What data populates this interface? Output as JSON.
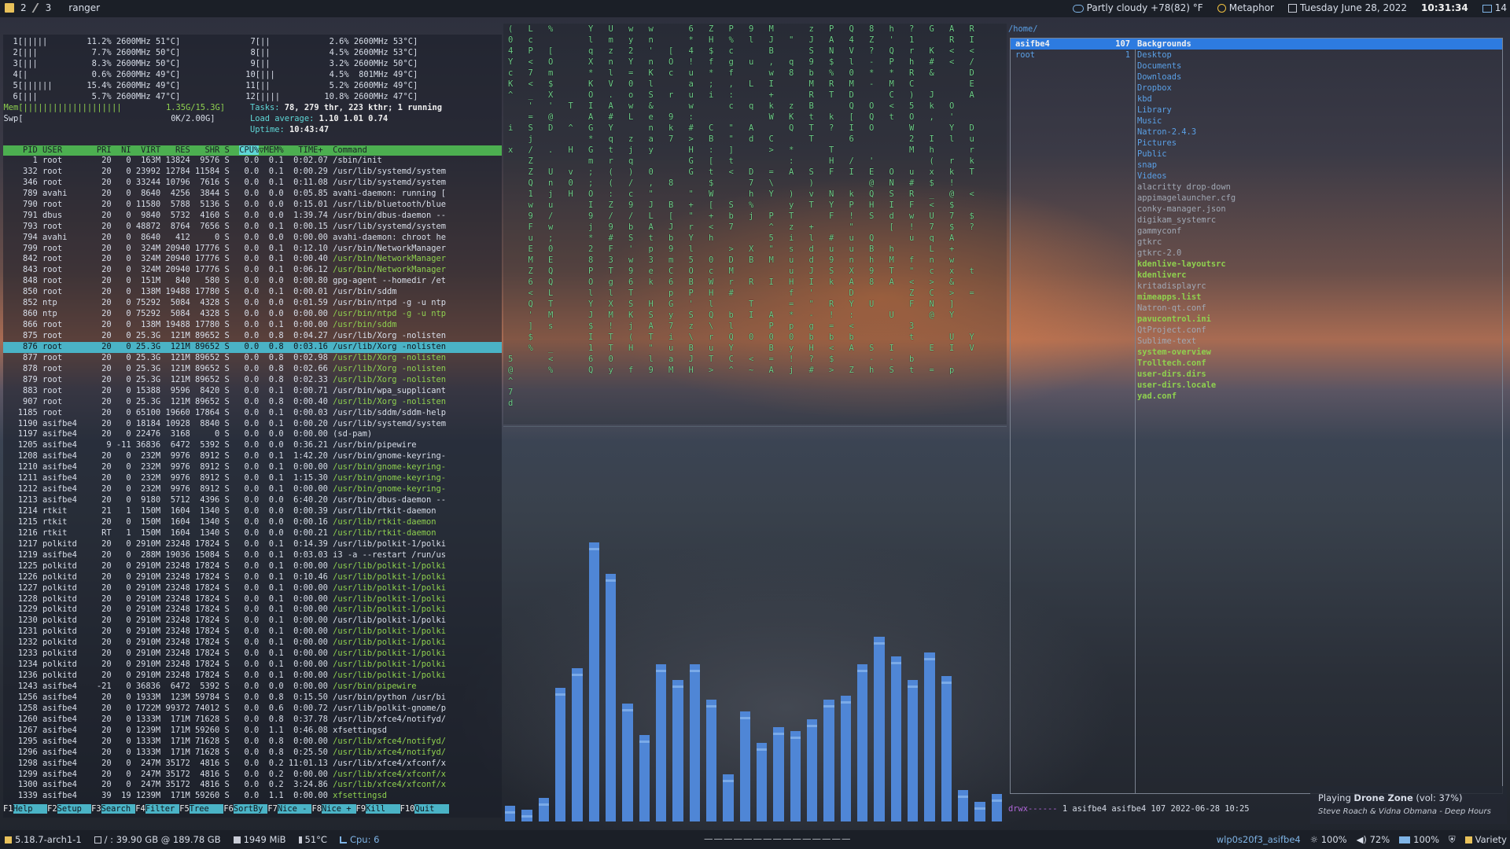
{
  "topbar": {
    "ws1_num": "2",
    "ws2_num": "3",
    "window_title": "ranger",
    "weather": "Partly cloudy +78(82) °F",
    "music": "Metaphor",
    "date": "Tuesday  June 28, 2022",
    "time": "10:31:34",
    "notif_count": "14"
  },
  "htop": {
    "cpu_lines": [
      "  1[|||||        11.2% 2600MHz 51°C]",
      "  2[|||           7.7% 2600MHz 50°C]",
      "  3[|||           8.3% 2600MHz 50°C]",
      "  4[|             0.6% 2600MHz 49°C]",
      "  5[||||||       15.4% 2600MHz 49°C]",
      "  6[|||           5.7% 2600MHz 47°C]"
    ],
    "cpu_lines_r": [
      "  7[||            2.6% 2600MHz 53°C]",
      "  8[||            4.5% 2600MHz 53°C]",
      "  9[||            3.2% 2600MHz 50°C]",
      " 10[|||           4.5%  801MHz 49°C]",
      " 11[||            5.2% 2600MHz 49°C]",
      " 12[||||         10.8% 2600MHz 47°C]"
    ],
    "mem_line": "  Mem[||||||||||||||||||||         1.35G/15.3G]",
    "swp_line": "  Swp[                              0K/2.00G]",
    "tasks_label": "Tasks: ",
    "tasks_val": "78, 279 thr, 223 kthr; 1 running",
    "load_label": "Load average: ",
    "load_val": "1.10 1.01 0.74",
    "uptime_label": "Uptime: ",
    "uptime_val": "10:43:47",
    "header_a": "    PID USER       PRI  NI  VIRT   RES   SHR S  ",
    "header_sort": "CPU%",
    "header_b": "▽MEM%   TIME+  Command",
    "processes": [
      [
        "      1 root        20   0  163M 13824  9576 S   0.0  0.1  0:02.07 ",
        "/sbin/init",
        "n"
      ],
      [
        "    332 root        20   0 23992 12784 11584 S   0.0  0.1  0:00.29 ",
        "/usr/lib/systemd/system",
        "n"
      ],
      [
        "    346 root        20   0 33244 10796  7616 S   0.0  0.1  0:11.08 ",
        "/usr/lib/systemd/system",
        "n"
      ],
      [
        "    789 avahi       20   0  8640  4256  3844 S   0.0  0.0  0:05.85 ",
        "avahi-daemon: running [",
        "n"
      ],
      [
        "    790 root        20   0 11580  5788  5136 S   0.0  0.0  0:15.01 ",
        "/usr/lib/bluetooth/blue",
        "n"
      ],
      [
        "    791 dbus        20   0  9840  5732  4160 S   0.0  0.0  1:39.74 ",
        "/usr/bin/dbus-daemon --",
        "n"
      ],
      [
        "    793 root        20   0 48872  8764  7656 S   0.0  0.1  0:00.15 ",
        "/usr/lib/systemd/system",
        "n"
      ],
      [
        "    794 avahi       20   0  8640   412     0 S   0.0  0.0  0:00.00 ",
        "avahi-daemon: chroot he",
        "n"
      ],
      [
        "    799 root        20   0  324M 20940 17776 S   0.0  0.1  0:12.10 ",
        "/usr/bin/NetworkManager",
        "n"
      ],
      [
        "    842 root        20   0  324M 20940 17776 S   0.0  0.1  0:00.40 ",
        "/usr/bin/NetworkManager",
        "g"
      ],
      [
        "    843 root        20   0  324M 20940 17776 S   0.0  0.1  0:06.12 ",
        "/usr/bin/NetworkManager",
        "g"
      ],
      [
        "    848 root        20   0  151M   840   580 S   0.0  0.0  0:00.80 ",
        "gpg-agent --homedir /et",
        "n"
      ],
      [
        "    850 root        20   0  138M 19488 17780 S   0.0  0.1  0:00.01 ",
        "/usr/bin/sddm",
        "n"
      ],
      [
        "    852 ntp         20   0 75292  5084  4328 S   0.0  0.0  0:01.59 ",
        "/usr/bin/ntpd -g -u ntp",
        "n"
      ],
      [
        "    860 ntp         20   0 75292  5084  4328 S   0.0  0.0  0:00.00 ",
        "/usr/bin/ntpd -g -u ntp",
        "g"
      ],
      [
        "    866 root        20   0  138M 19488 17780 S   0.0  0.1  0:00.00 ",
        "/usr/bin/sddm",
        "g"
      ],
      [
        "    875 root        20   0 25.3G  121M 89652 S   0.0  0.8  0:04.27 ",
        "/usr/lib/Xorg -nolisten",
        "n"
      ],
      [
        "    876 root        20   0 25.3G  121M 89652 S   0.0  0.8  0:03.16 ",
        "/usr/lib/Xorg -nolisten",
        "s"
      ],
      [
        "    877 root        20   0 25.3G  121M 89652 S   0.0  0.8  0:02.98 ",
        "/usr/lib/Xorg -nolisten",
        "g"
      ],
      [
        "    878 root        20   0 25.3G  121M 89652 S   0.0  0.8  0:02.66 ",
        "/usr/lib/Xorg -nolisten",
        "g"
      ],
      [
        "    879 root        20   0 25.3G  121M 89652 S   0.0  0.8  0:02.33 ",
        "/usr/lib/Xorg -nolisten",
        "g"
      ],
      [
        "    883 root        20   0 15388  9596  8420 S   0.0  0.1  0:00.71 ",
        "/usr/bin/wpa_supplicant",
        "n"
      ],
      [
        "    907 root        20   0 25.3G  121M 89652 S   0.0  0.8  0:00.40 ",
        "/usr/lib/Xorg -nolisten",
        "g"
      ],
      [
        "   1185 root        20   0 65100 19660 17864 S   0.0  0.1  0:00.03 ",
        "/usr/lib/sddm/sddm-help",
        "n"
      ],
      [
        "   1190 asifbe4     20   0 18184 10928  8840 S   0.0  0.1  0:00.20 ",
        "/usr/lib/systemd/system",
        "n"
      ],
      [
        "   1197 asifbe4     20   0 22476  3168     0 S   0.0  0.0  0:00.00 ",
        "(sd-pam)",
        "n"
      ],
      [
        "   1205 asifbe4      9 -11 36836  6472  5392 S   0.0  0.0  0:36.21 ",
        "/usr/bin/pipewire",
        "n"
      ],
      [
        "   1208 asifbe4     20   0  232M  9976  8912 S   0.0  0.1  1:42.20 ",
        "/usr/bin/gnome-keyring-",
        "n"
      ],
      [
        "   1210 asifbe4     20   0  232M  9976  8912 S   0.0  0.1  0:00.00 ",
        "/usr/bin/gnome-keyring-",
        "g"
      ],
      [
        "   1211 asifbe4     20   0  232M  9976  8912 S   0.0  0.1  1:15.30 ",
        "/usr/bin/gnome-keyring-",
        "g"
      ],
      [
        "   1212 asifbe4     20   0  232M  9976  8912 S   0.0  0.1  0:00.00 ",
        "/usr/bin/gnome-keyring-",
        "g"
      ],
      [
        "   1213 asifbe4     20   0  9180  5712  4396 S   0.0  0.0  6:40.20 ",
        "/usr/bin/dbus-daemon --",
        "n"
      ],
      [
        "   1214 rtkit       21   1  150M  1604  1340 S   0.0  0.0  0:00.39 ",
        "/usr/lib/rtkit-daemon",
        "n"
      ],
      [
        "   1215 rtkit       20   0  150M  1604  1340 S   0.0  0.0  0:00.16 ",
        "/usr/lib/rtkit-daemon",
        "g"
      ],
      [
        "   1216 rtkit       RT   1  150M  1604  1340 S   0.0  0.0  0:00.21 ",
        "/usr/lib/rtkit-daemon",
        "g"
      ],
      [
        "   1217 polkitd     20   0 2910M 23248 17824 S   0.0  0.1  0:14.39 ",
        "/usr/lib/polkit-1/polki",
        "n"
      ],
      [
        "   1219 asifbe4     20   0  288M 19036 15084 S   0.0  0.1  0:03.03 ",
        "i3 -a --restart /run/us",
        "n"
      ],
      [
        "   1225 polkitd     20   0 2910M 23248 17824 S   0.0  0.1  0:00.00 ",
        "/usr/lib/polkit-1/polki",
        "g"
      ],
      [
        "   1226 polkitd     20   0 2910M 23248 17824 S   0.0  0.1  0:10.46 ",
        "/usr/lib/polkit-1/polki",
        "g"
      ],
      [
        "   1227 polkitd     20   0 2910M 23248 17824 S   0.0  0.1  0:00.00 ",
        "/usr/lib/polkit-1/polki",
        "g"
      ],
      [
        "   1228 polkitd     20   0 2910M 23248 17824 S   0.0  0.1  0:00.00 ",
        "/usr/lib/polkit-1/polki",
        "g"
      ],
      [
        "   1229 polkitd     20   0 2910M 23248 17824 S   0.0  0.1  0:00.00 ",
        "/usr/lib/polkit-1/polki",
        "g"
      ],
      [
        "   1230 polkitd     20   0 2910M 23248 17824 S   0.0  0.1  0:00.00 ",
        "/usr/lib/polkit-1/polki",
        "n"
      ],
      [
        "   1231 polkitd     20   0 2910M 23248 17824 S   0.0  0.1  0:00.00 ",
        "/usr/lib/polkit-1/polki",
        "g"
      ],
      [
        "   1232 polkitd     20   0 2910M 23248 17824 S   0.0  0.1  0:00.00 ",
        "/usr/lib/polkit-1/polki",
        "g"
      ],
      [
        "   1233 polkitd     20   0 2910M 23248 17824 S   0.0  0.1  0:00.00 ",
        "/usr/lib/polkit-1/polki",
        "g"
      ],
      [
        "   1234 polkitd     20   0 2910M 23248 17824 S   0.0  0.1  0:00.00 ",
        "/usr/lib/polkit-1/polki",
        "g"
      ],
      [
        "   1236 polkitd     20   0 2910M 23248 17824 S   0.0  0.1  0:00.00 ",
        "/usr/lib/polkit-1/polki",
        "g"
      ],
      [
        "   1243 asifbe4    -21   0 36836  6472  5392 S   0.0  0.0  0:00.00 ",
        "/usr/bin/pipewire",
        "g"
      ],
      [
        "   1256 asifbe4     20   0 1933M  123M 59784 S   0.0  0.8  0:15.50 ",
        "/usr/bin/python /usr/bi",
        "n"
      ],
      [
        "   1258 asifbe4     20   0 1722M 99372 74012 S   0.0  0.6  0:00.72 ",
        "/usr/lib/polkit-gnome/p",
        "n"
      ],
      [
        "   1260 asifbe4     20   0 1333M  171M 71628 S   0.0  0.8  0:37.78 ",
        "/usr/lib/xfce4/notifyd/",
        "n"
      ],
      [
        "   1267 asifbe4     20   0 1239M  171M 59260 S   0.0  1.1  0:46.08 ",
        "xfsettingsd",
        "n"
      ],
      [
        "   1295 asifbe4     20   0 1333M  171M 71628 S   0.0  0.8  0:00.00 ",
        "/usr/lib/xfce4/notifyd/",
        "g"
      ],
      [
        "   1296 asifbe4     20   0 1333M  171M 71628 S   0.0  0.8  0:25.50 ",
        "/usr/lib/xfce4/notifyd/",
        "g"
      ],
      [
        "   1298 asifbe4     20   0  247M 35172  4816 S   0.0  0.2 11:01.13 ",
        "/usr/lib/xfce4/xfconf/x",
        "n"
      ],
      [
        "   1299 asifbe4     20   0  247M 35172  4816 S   0.0  0.2  0:00.00 ",
        "/usr/lib/xfce4/xfconf/x",
        "g"
      ],
      [
        "   1300 asifbe4     20   0  247M 35172  4816 S   0.0  0.2  3:24.86 ",
        "/usr/lib/xfce4/xfconf/x",
        "g"
      ],
      [
        "   1339 asifbe4     39  19 1239M  171M 59260 S   0.0  1.1  0:00.00 ",
        "xfsettingsd",
        "g"
      ]
    ],
    "fkeys": [
      [
        "F1",
        "Help  "
      ],
      [
        "F2",
        "Setup "
      ],
      [
        "F3",
        "Search"
      ],
      [
        "F4",
        "Filter"
      ],
      [
        "F5",
        "Tree  "
      ],
      [
        "F6",
        "SortBy"
      ],
      [
        "F7",
        "Nice -"
      ],
      [
        "F8",
        "Nice +"
      ],
      [
        "F9",
        "Kill  "
      ],
      [
        "F10",
        "Quit  "
      ]
    ]
  },
  "matrix": {
    "columns": [
      "(\n0\n4\nY\nc\nK\n^\n\n\ni\n\nx\n\n\n\n\n\n\n\n\n\n\n\n\n\n\n\n\n\n\n5\n@\n^\n7\nd",
      "L\nc\nP\n<\n7\n<\n_\n'\n=\nS\nj\n/\nZ\nZ\nQ\n1\nw\n9\nF\nu\nE\nM\nZ\n6\n<\nQ\n'\n]\n$\n%\n",
      "%\n\n[\nO\nm\n$\nX\n'\n@\nD\n\n.\n\nU\nn\nj\nu\n/\nw\n;\n0\nE\nQ\nQ\nL\nT\nM\ns\n\n_\n<\n%",
      "\n\n\n\n\n\n\nT\n\n^\n\nH\n\nv\n0\nH\n\n\n\n\n\n\n\n\n\n\n\n\n\n\n\n\n",
      "Y\nl\nq\nX\n*\nK\nO\nI\nA\nG\n*\nG\nm\n;\n;\nO\nI\n9\nj\n*\n2\n8\nP\nO\nl\nY\nJ\n$\nI\n1\n6\nQ",
      "U\nm\nz\nn\nl\nV\n.\nA\n#\nY\nq\nt\nr\n(\n(\n:\nZ\n/\n9\n#\nF\n3\nT\ng\nl\nX\nM\n!\nT\nT\n0\ny",
      "w\ny\n2\nY\n=\n0\no\nw\nL\n\nz\nj\nq\n)\n/\nc\n9\n/\nb\nS\n'\nw\n9\n6\nT\nS\nK\nj\n(\nH\n\nf",
      "w\nn\n'\nn\nK\nl\nS\n&\ne\nn\na\ny\n\n0\n,\n\"\nJ\nL\nA\nt\np\n3\ne\nk\n\nH\nS\nA\nT\n\"\nl\n9",
      "\n\n[\nO\nc\n\nr\n\n9\nk\n7\n\n\n\n8\n\nB\n[\nJ\nb\n9\nm\nC\n6\np\nG\ny\n7\ni\nu\na\nM",
      "6\n*\n4\n!\nu\na\nu\nw\n:\n#\n>\nH\nG\nG\n\n\"\n+\n\"\nr\nY\nl\n5\nO\nB\nP\n'\nS\nz\n\\\nB\nJ\nH",
      "Z\nH\n$\nf\n*\n;\ni\n\n\nC\nB\n:\n[\nt\n$\nW\n[\n+\n<\nh\n\n0\nc\nW\nH\nl\nQ\n\\\nr\nu\nT\n>",
      "P\n%\nc\ng\nf\n,\n:\nc\n\n\"\n\"\n]\nt\n<\n\n\nS\nb\n7\n\n>\nD\nM\nr\n#\n\nb\nl\nQ\nY\nC\n^",
      "9\nl\n\nu\n\nL\n\nq\n\nA\nd\n\n\nD\n7\nh\n%\nj\n\n\nX\nB\n\nR\n\nT\nI\n\n0\n\n<\n~",
      "M\nJ\nB\n,\nw\nI\n+\nk\nW\n\nC\n>\n\n=\n\\\nY\n\nP\n^\n5\n\"\nM\n\nI\n\n\nA\nP\n0\nB\n=\nA",
      "\n\"\n\nq\n8\n\n\nz\nK\nQ\n\n*\n:\nA\n\n)\ny\nT\nz\ni\ns\nu\nu\nH\nf\n=\n*\np\n0\ny\n!\nj",
      "z\nJ\nS\n9\nb\nM\nR\nB\nt\nT\nT\n\n\nS\n)\nv\nT\n\n+\nl\nd\nd\nJ\nI\n'\n\"\n-\ng\nb\nH\n?\n#",
      "P\nA\nN\n$\n%\nR\nT\n\nk\n?\n\nT\nH\nF\n\nN\nY\nF\n\n#\nu\n9\nS\nk\n\nR\n!\n=\nb\n<\n$\n>",
      "Q\n4\nV\nl\n0\nM\nD\nQ\n[\nI\n6\n\n/\nI\n\nk\nP\n!\n\"\nu\nu\nn\nX\nA\nD\nY\n:\n<\nb\nA\n\nZ",
      "8\nZ\n?\n-\n*\n-\n\nO\nQ\nO\n\n\n'\nE\n@\nQ\nH\nS\n\nQ\nB\nh\n9\n8\n\nU\n\n\n\nS\n-\nh",
      "h\n'\nQ\nP\n*\nM\nC\n<\nt\n\n\n\n\nO\nN\nS\nI\nd\n[\n\nh\nM\nT\nA\n\n\nU\n\n\nI\n-\nS",
      "?\n1\nr\nh\nR\nC\n)\n5\nO\nW\n2\nM\n\nu\n#\nR\nF\nw\n!\nu\n\nf\n\"\n<\nZ\nF\n\n3\nt\n\nb\nt",
      "G\n\nK\n#\n&\n\nJ\nk\n,\n\nI\nh\n(\nx\n$\n_\n<\nU\n7\nq\nL\nn\nc\n>\nC\nN\n@\n\n\nE\n\n=",
      "A\nR\n<\n<\n\n\n\nO\n'\nY\nl\n\nr\nk\n!\n@\n$\n7\n$\nA\n+\nw\nx\n&\n>\n]\nY\n\nU\nI\n\np",
      "R\nI\n<\n/\nD\nE\nA\n\n\nD\nu\nr\nk\nT\n\n<\n\n$\n?\n\n\n\nt\n\n=\n\n\n\nY\nV\n\n\n",
      "\n\n\n\n\n\n\n\n\n\n\n\n\n\n\n\n\n\n\n\n\n\n\n\n\n\n\n\n\n\n\n"
    ]
  },
  "visualizer": {
    "levels": [
      0.04,
      0.03,
      0.06,
      0.34,
      0.39,
      0.71,
      0.63,
      0.3,
      0.22,
      0.4,
      0.36,
      0.4,
      0.31,
      0.12,
      0.28,
      0.2,
      0.24,
      0.23,
      0.26,
      0.31,
      0.32,
      0.4,
      0.47,
      0.42,
      0.36,
      0.43,
      0.37,
      0.08,
      0.05,
      0.07
    ],
    "color": "#4f86d6"
  },
  "ranger": {
    "path": "/home/",
    "col1": [
      [
        "asifbe4",
        "107",
        "sel"
      ],
      [
        "root",
        "1",
        "dir"
      ]
    ],
    "col2": [
      [
        "Backgrounds",
        "sel"
      ],
      [
        "Desktop",
        "dir"
      ],
      [
        "Documents",
        "dir"
      ],
      [
        "Downloads",
        "dir"
      ],
      [
        "Dropbox",
        "dir"
      ],
      [
        "kbd",
        "dir"
      ],
      [
        "Library",
        "dir"
      ],
      [
        "Music",
        "dir"
      ],
      [
        "Natron-2.4.3",
        "dir"
      ],
      [
        "Pictures",
        "dir"
      ],
      [
        "Public",
        "dir"
      ],
      [
        "snap",
        "dir"
      ],
      [
        "Videos",
        "dir"
      ],
      [
        "alacritty drop-down",
        "plain"
      ],
      [
        "appimagelauncher.cfg",
        "plain"
      ],
      [
        "conky-manager.json",
        "plain"
      ],
      [
        "digikam_systemrc",
        "plain"
      ],
      [
        "gammyconf",
        "plain"
      ],
      [
        "gtkrc",
        "plain"
      ],
      [
        "gtkrc-2.0",
        "plain"
      ],
      [
        "kdenlive-layoutsrc",
        "exe"
      ],
      [
        "kdenliverc",
        "exe"
      ],
      [
        "kritadisplayrc",
        "plain"
      ],
      [
        "mimeapps.list",
        "exe"
      ],
      [
        "Natron-qt.conf",
        "plain"
      ],
      [
        "pavucontrol.ini",
        "exe"
      ],
      [
        "QtProject.conf",
        "plain"
      ],
      [
        "Sublime-text",
        "plain"
      ],
      [
        "system-overview",
        "exe"
      ],
      [
        "Trolltech.conf",
        "exe"
      ],
      [
        "user-dirs.dirs",
        "exe"
      ],
      [
        "user-dirs.locale",
        "exe"
      ],
      [
        "yad.conf",
        "exe"
      ]
    ],
    "status_perm": "drwx------",
    "status_rest": " 1 asifbe4 asifbe4 107 2022-06-28 10:25"
  },
  "notification": {
    "line1_prefix": "Playing ",
    "line1_bold": "Drone Zone",
    "line1_suffix": " (vol: 37%)",
    "line2": "Steve Roach & Vidna Obmana - Deep Hours"
  },
  "bottombar": {
    "kernel": "5.18.7-arch1-1",
    "disk": "/ : 39.90 GB @ 189.78 GB",
    "mem": "1949 MiB",
    "temp": "51°C",
    "cpu": "Cpu: 6",
    "center": "———————————————",
    "net": "wlp0s20f3_asifbe4",
    "brightness": "100%",
    "volume": "72%",
    "battery": "100%",
    "wallpaper": "Variety"
  }
}
